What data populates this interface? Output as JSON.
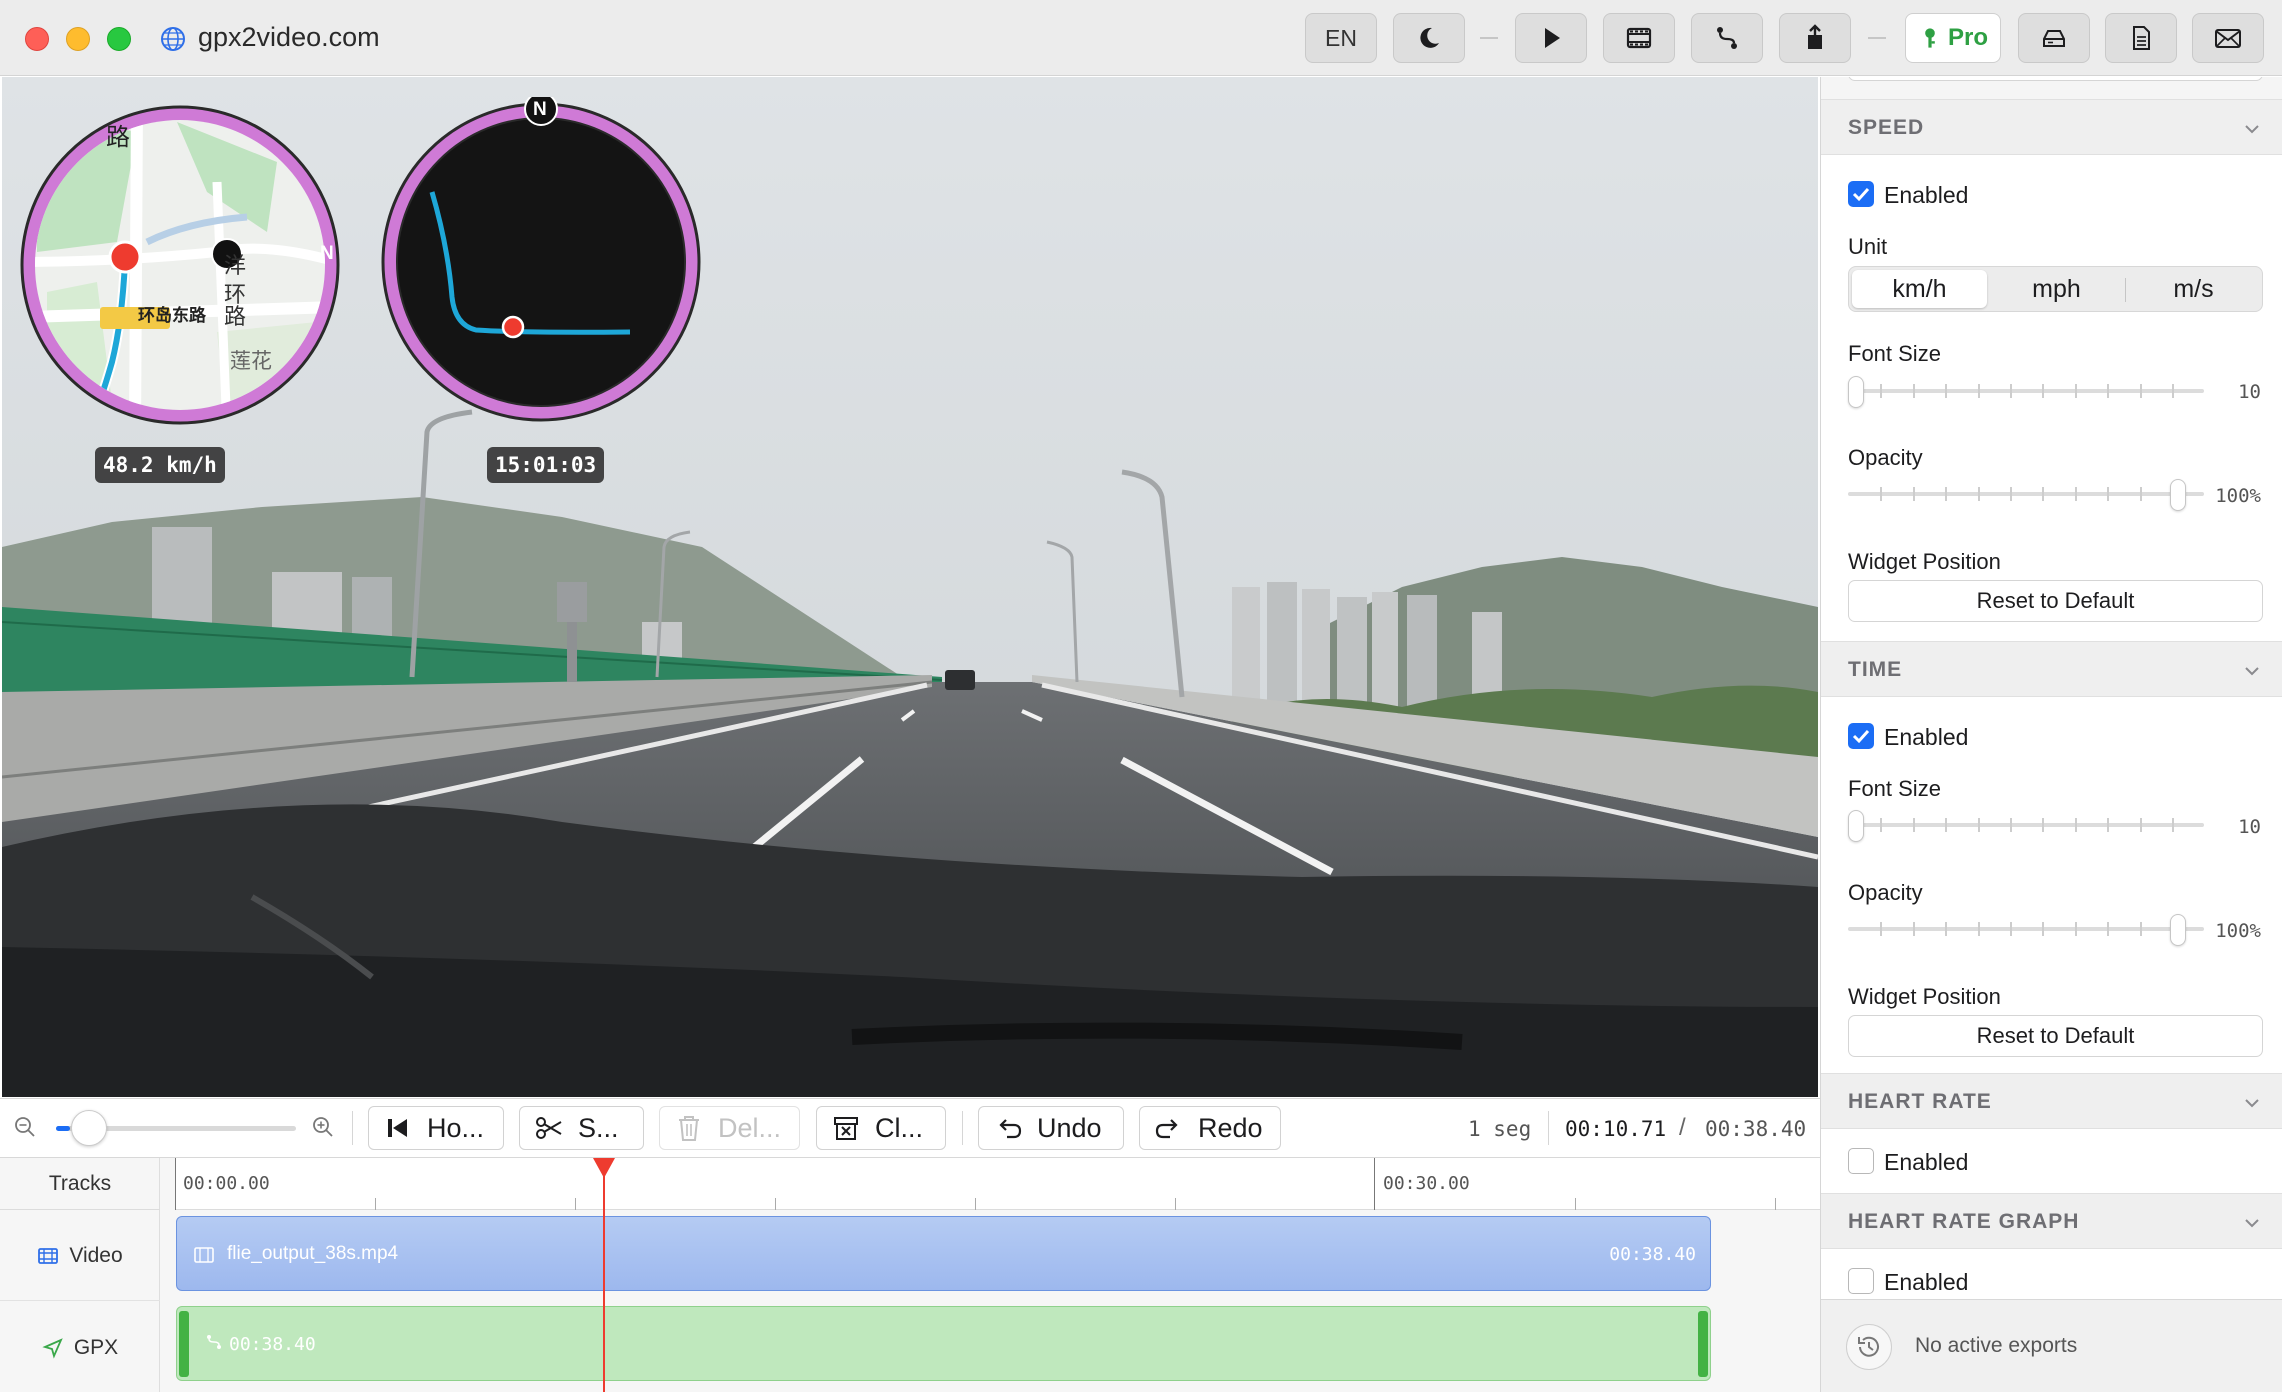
{
  "window": {
    "url": "gpx2video.com"
  },
  "toolbar": {
    "language": "EN",
    "pro_label": "Pro"
  },
  "overlays": {
    "speed_label": "48.2 km/h",
    "time_label": "15:01:03",
    "north_label": "N",
    "map_labels": [
      "路",
      "洋",
      "环",
      "路",
      "环岛东路",
      "莲花"
    ]
  },
  "timeline_toolbar": {
    "home_label": "Ho...",
    "split_label": "S...",
    "delete_label": "Del...",
    "clear_label": "Cl...",
    "undo_label": "Undo",
    "redo_label": "Redo",
    "segment_count": "1 seg",
    "current_time": "00:10.71",
    "separator": "/",
    "total_time": "00:38.40"
  },
  "tracks": {
    "header": "Tracks",
    "ruler": [
      "00:00.00",
      "00:30.00"
    ],
    "video_label": "Video",
    "gpx_label": "GPX",
    "video_clip": {
      "name": "flie_output_38s.mp4",
      "duration": "00:38.40"
    },
    "gpx_clip": {
      "duration": "00:38.40"
    },
    "playhead_time": "00:10.71"
  },
  "sidebar": {
    "speed": {
      "title": "SPEED",
      "enabled_label": "Enabled",
      "enabled": true,
      "unit_label": "Unit",
      "units": [
        "km/h",
        "mph",
        "m/s"
      ],
      "selected_unit": "km/h",
      "font_size_label": "Font Size",
      "font_size_value": "10",
      "opacity_label": "Opacity",
      "opacity_value": "100%",
      "position_label": "Widget Position",
      "reset_label": "Reset to Default"
    },
    "time": {
      "title": "TIME",
      "enabled_label": "Enabled",
      "enabled": true,
      "font_size_label": "Font Size",
      "font_size_value": "10",
      "opacity_label": "Opacity",
      "opacity_value": "100%",
      "position_label": "Widget Position",
      "reset_label": "Reset to Default"
    },
    "heart_rate": {
      "title": "HEART RATE",
      "enabled_label": "Enabled",
      "enabled": false
    },
    "heart_rate_graph": {
      "title": "HEART RATE GRAPH",
      "enabled_label": "Enabled",
      "enabled": false
    },
    "exports_status": "No active exports"
  },
  "colors": {
    "accent": "#1b6df5",
    "pro_green": "#2ea043",
    "playhead": "#ee3b2f",
    "widget_ring": "#cf7ad6",
    "route_line": "#1ea7d8"
  }
}
